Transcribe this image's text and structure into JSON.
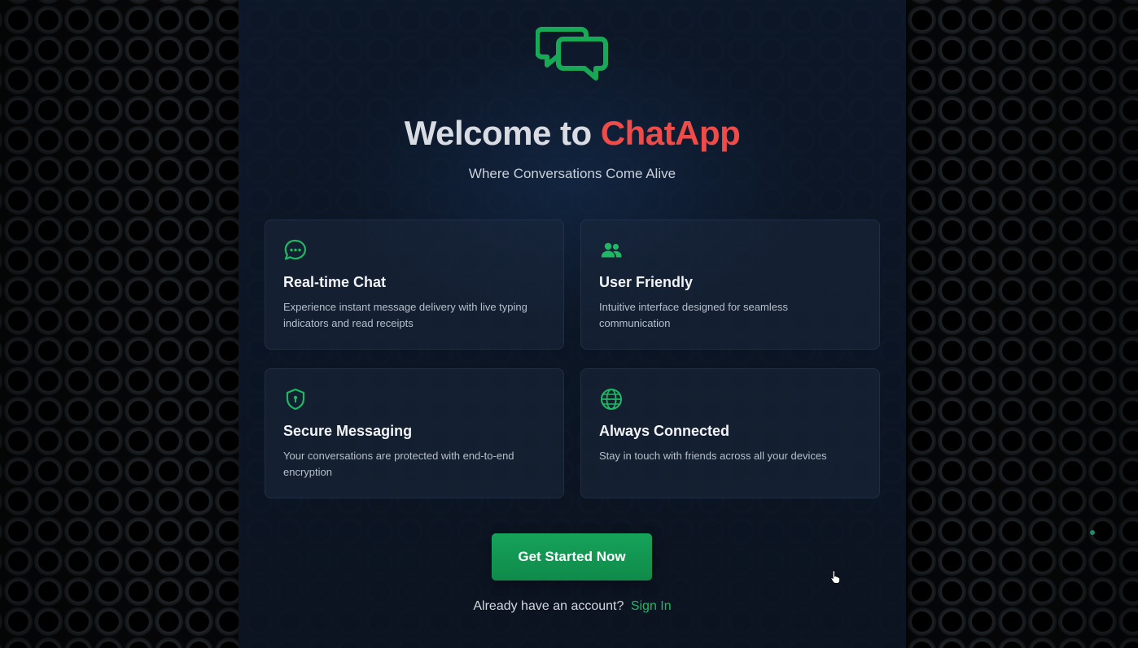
{
  "app": {
    "logo_icon": "chat-bubbles-icon",
    "title_lead": "Welcome to ",
    "title_brand": "ChatApp",
    "subtitle": "Where Conversations Come Alive"
  },
  "features": [
    {
      "icon": "chat-bubble-dots-icon",
      "title": "Real-time Chat",
      "description": "Experience instant message delivery with live typing indicators and read receipts"
    },
    {
      "icon": "users-icon",
      "title": "User Friendly",
      "description": "Intuitive interface designed for seamless communication"
    },
    {
      "icon": "shield-lock-icon",
      "title": "Secure Messaging",
      "description": "Your conversations are protected with end-to-end encryption"
    },
    {
      "icon": "globe-icon",
      "title": "Always Connected",
      "description": "Stay in touch with friends across all your devices"
    }
  ],
  "cta": {
    "label": "Get Started Now"
  },
  "signin": {
    "prompt": "Already have an account?",
    "link_label": "Sign In"
  },
  "colors": {
    "accent": "#16a35a",
    "brand": "#ef4b48",
    "link": "#1fb865"
  }
}
